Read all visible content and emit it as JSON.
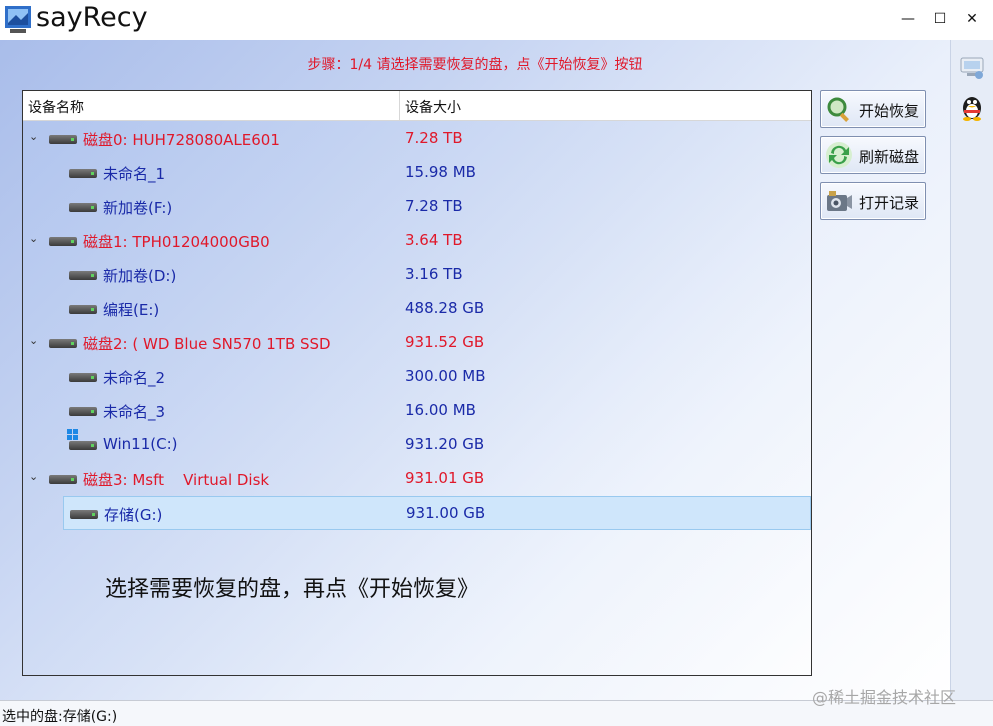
{
  "window": {
    "title": "sayRecy",
    "minimize_glyph": "—",
    "maximize_glyph": "☐",
    "close_glyph": "✕"
  },
  "step": "步骤：1/4 请选择需要恢复的盘，点《开始恢复》按钮",
  "tree": {
    "columns": [
      "设备名称",
      "设备大小"
    ],
    "rows": [
      {
        "type": "disk",
        "name": "磁盘0: HUH728080ALE601",
        "size": "7.28 TB"
      },
      {
        "type": "part",
        "name": "未命名_1",
        "size": "15.98 MB"
      },
      {
        "type": "part",
        "name": "新加卷(F:)",
        "size": "7.28 TB"
      },
      {
        "type": "disk",
        "name": "磁盘1: TPH01204000GB0",
        "size": "3.64 TB"
      },
      {
        "type": "part",
        "name": "新加卷(D:)",
        "size": "3.16 TB"
      },
      {
        "type": "part",
        "name": "编程(E:)",
        "size": "488.28 GB"
      },
      {
        "type": "disk",
        "name": "磁盘2: ( WD Blue SN570 1TB SSD",
        "size": "931.52 GB"
      },
      {
        "type": "part",
        "name": "未命名_2",
        "size": "300.00 MB"
      },
      {
        "type": "part",
        "name": "未命名_3",
        "size": "16.00 MB"
      },
      {
        "type": "part",
        "name": "Win11(C:)",
        "size": "931.20 GB",
        "windows": true
      },
      {
        "type": "disk",
        "name": "磁盘3: Msft    Virtual Disk",
        "size": "931.01 GB"
      },
      {
        "type": "part",
        "name": "存储(G:)",
        "size": "931.00 GB",
        "selected": true
      }
    ]
  },
  "hint": "选择需要恢复的盘，再点《开始恢复》",
  "buttons": {
    "start": "开始恢复",
    "refresh": "刷新磁盘",
    "log": "打开记录"
  },
  "status": "选中的盘:存储(G:)",
  "watermark": "@稀土掘金技术社区",
  "colors": {
    "disk_text": "#e0182a",
    "partition_text": "#1a2aa8",
    "selection": "#cfe6fb"
  }
}
